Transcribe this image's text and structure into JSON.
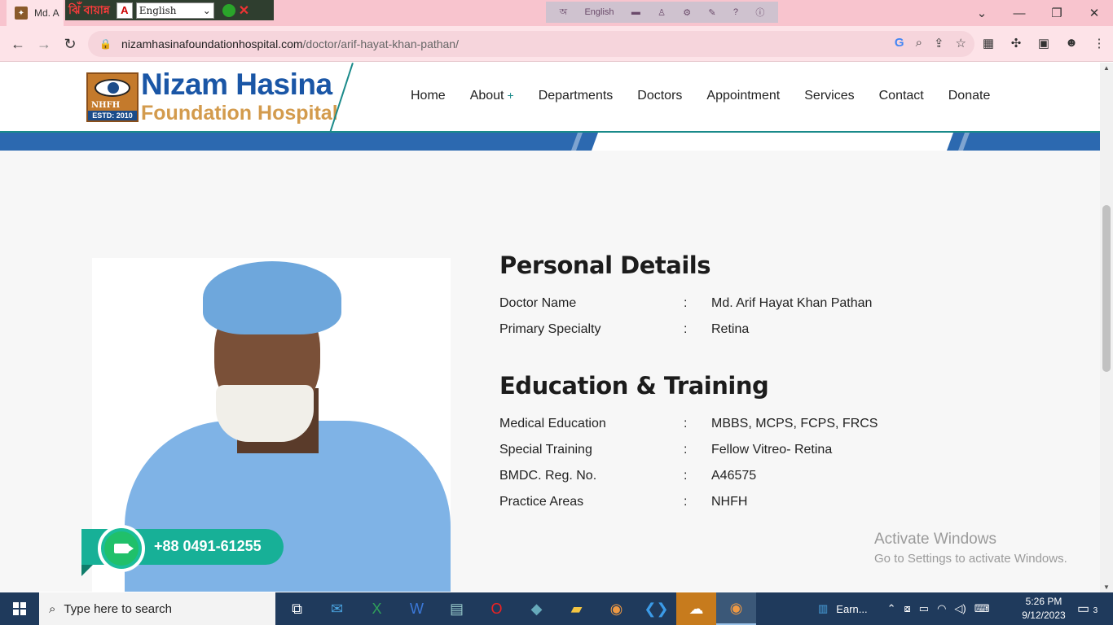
{
  "browser": {
    "tab_title": "Md. A",
    "ime": {
      "logo": "ঝিঁ",
      "name": "বায়ান্ন",
      "language_value": "English"
    },
    "center_toolbar": {
      "language": "English"
    },
    "url_host": "nizamhasinafoundationhospital.com",
    "url_path": "/doctor/arif-hayat-khan-pathan/"
  },
  "site": {
    "brand_line1": "Nizam Hasina",
    "brand_line2": "Foundation Hospital",
    "logo_text": "NHFH",
    "logo_estd": "ESTD: 2010",
    "nav": [
      "Home",
      "About",
      "Departments",
      "Doctors",
      "Appointment",
      "Services",
      "Contact",
      "Donate"
    ],
    "about_plus": "+"
  },
  "personal": {
    "title": "Personal Details",
    "rows": [
      {
        "label": "Doctor Name",
        "sep": ":",
        "value": "Md. Arif Hayat Khan Pathan"
      },
      {
        "label": "Primary Specialty",
        "sep": ":",
        "value": "Retina"
      }
    ]
  },
  "education": {
    "title": "Education & Training",
    "rows": [
      {
        "label": "Medical Education",
        "sep": ":",
        "value": "MBBS, MCPS, FCPS, FRCS"
      },
      {
        "label": "Special Training",
        "sep": ":",
        "value": "Fellow Vitreo- Retina"
      },
      {
        "label": "BMDC. Reg. No.",
        "sep": ":",
        "value": "A46575"
      },
      {
        "label": "Practice Areas",
        "sep": ":",
        "value": "NHFH"
      }
    ]
  },
  "call": {
    "number": "+88 0491-61255"
  },
  "watermark": {
    "line1": "Activate Windows",
    "line2": "Go to Settings to activate Windows."
  },
  "taskbar": {
    "search_placeholder": "Type here to search",
    "tray_app": "Earn...",
    "time": "5:26 PM",
    "date": "9/12/2023",
    "notifications": "3"
  }
}
